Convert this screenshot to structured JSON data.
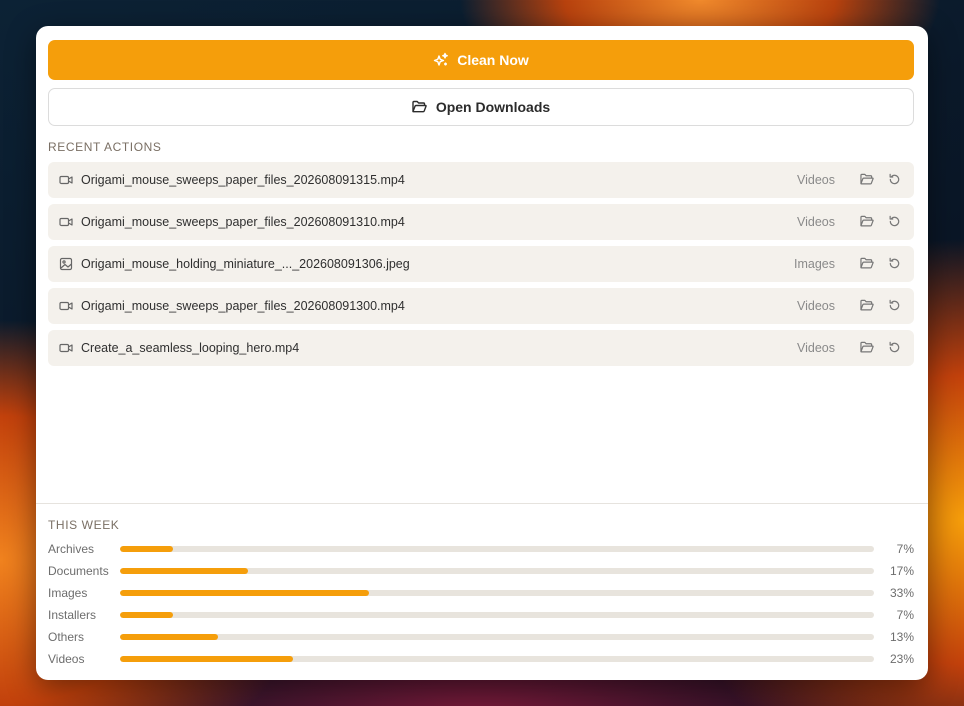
{
  "actions": {
    "clean_label": "Clean Now",
    "open_label": "Open Downloads"
  },
  "recent": {
    "title": "RECENT ACTIONS",
    "items": [
      {
        "name": "Origami_mouse_sweeps_paper_files_202608091315.mp4",
        "category": "Videos",
        "icon": "video-icon"
      },
      {
        "name": "Origami_mouse_sweeps_paper_files_202608091310.mp4",
        "category": "Videos",
        "icon": "video-icon"
      },
      {
        "name": "Origami_mouse_holding_miniature_..._202608091306.jpeg",
        "category": "Images",
        "icon": "image-icon"
      },
      {
        "name": "Origami_mouse_sweeps_paper_files_202608091300.mp4",
        "category": "Videos",
        "icon": "video-icon"
      },
      {
        "name": "Create_a_seamless_looping_hero.mp4",
        "category": "Videos",
        "icon": "video-icon"
      }
    ]
  },
  "week": {
    "title": "THIS WEEK",
    "stats": [
      {
        "label": "Archives",
        "percent": 7,
        "display": "7%"
      },
      {
        "label": "Documents",
        "percent": 17,
        "display": "17%"
      },
      {
        "label": "Images",
        "percent": 33,
        "display": "33%"
      },
      {
        "label": "Installers",
        "percent": 7,
        "display": "7%"
      },
      {
        "label": "Others",
        "percent": 13,
        "display": "13%"
      },
      {
        "label": "Videos",
        "percent": 23,
        "display": "23%"
      }
    ]
  },
  "colors": {
    "accent": "#f59e0b",
    "row_bg": "#f4f1ec",
    "track": "#e8e4dd"
  }
}
